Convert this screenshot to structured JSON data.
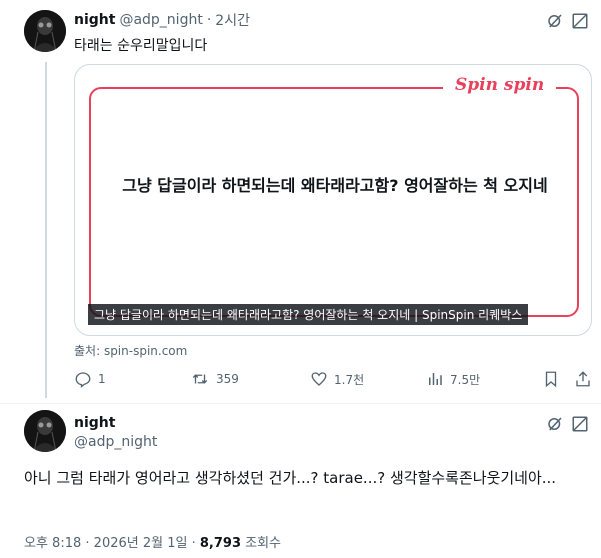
{
  "reply_tweet": {
    "display_name": "night",
    "handle": "@adp_night",
    "separator": "·",
    "time": "2시간",
    "text": "타래는 순우리말입니다",
    "card": {
      "brand": "Spin spin",
      "quote": "그냥 답글이라 하면되는데 왜타래라고함? 영어잘하는 척 오지네",
      "caption": "그냥 답글이라 하면되는데 왜타래라고함? 영어잘하는 척 오지네 | SpinSpin 리퀘박스"
    },
    "source": "출처: spin-spin.com",
    "actions": {
      "replies": "1",
      "retweets": "359",
      "likes": "1.7천",
      "views": "7.5만"
    }
  },
  "main_tweet": {
    "display_name": "night",
    "handle": "@adp_night",
    "text": "아니 그럼 타래가 영어라고 생각하셨던 건가...? tarae...? 생각할수록존나웃기네아...",
    "footer": {
      "time": "오후 8:18",
      "separator1": "·",
      "date": "2026년 2월 1일",
      "separator2": "·",
      "views": "8,793",
      "views_label": "조회수"
    }
  },
  "colors": {
    "brand": "#e8415b",
    "secondary_text": "#536471",
    "primary_text": "#0f1419"
  }
}
